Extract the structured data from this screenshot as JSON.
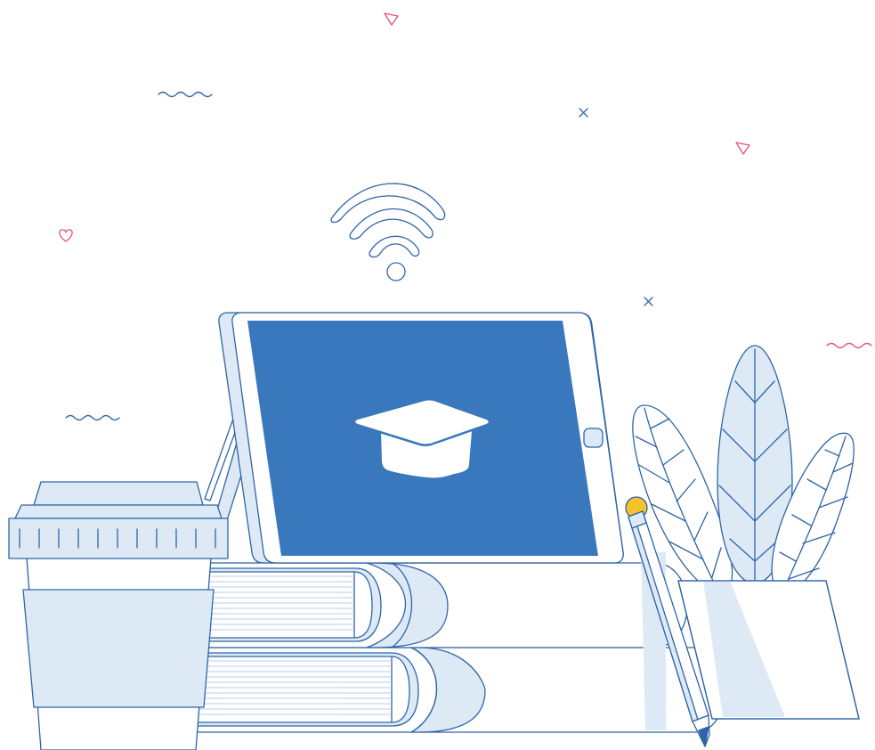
{
  "illustration": {
    "subject": "online-education",
    "icons": [
      "wifi-icon",
      "graduation-cap-icon",
      "coffee-cup-icon",
      "book-stack-icon",
      "pencil-icon",
      "plant-icon",
      "heart-icon",
      "triangle-icon",
      "cross-icon",
      "wave-icon"
    ]
  },
  "colors": {
    "outline": "#2e64a8",
    "fill_light": "#ddeaf6",
    "fill_screen": "#3a78bd",
    "accent_pink": "#e0507a",
    "accent_yellow": "#f4c22b",
    "background": "#ffffff"
  }
}
